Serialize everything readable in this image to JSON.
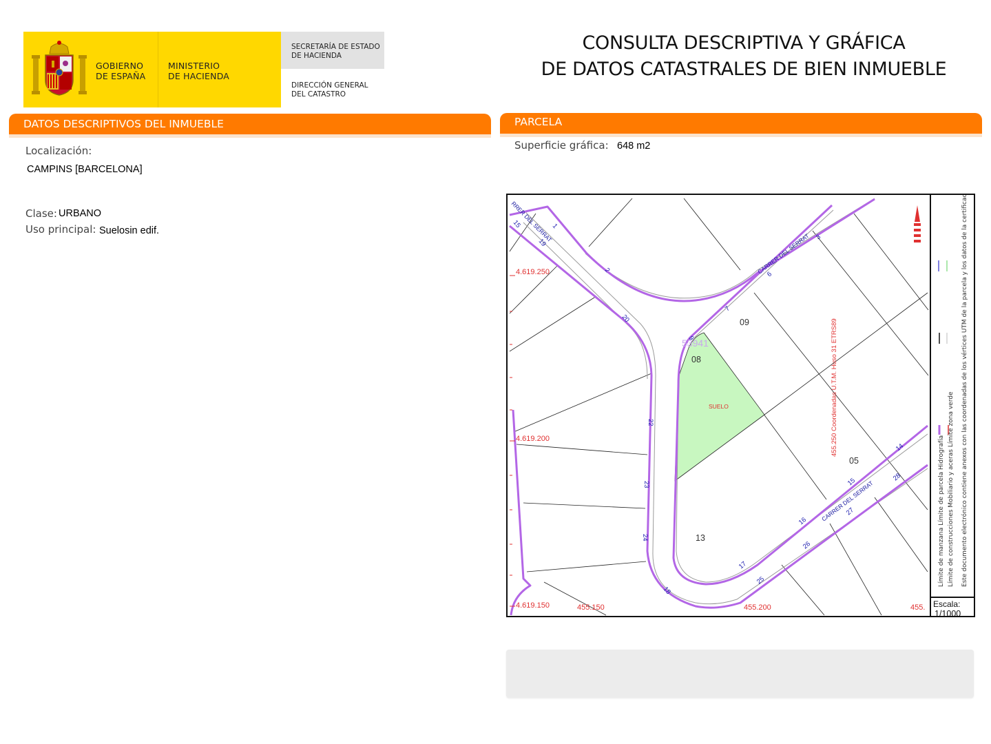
{
  "header": {
    "gov_line1": "GOBIERNO",
    "gov_line2": "DE ESPAÑA",
    "ministry_line1": "MINISTERIO",
    "ministry_line2": "DE HACIENDA",
    "secretaria_line1": "SECRETARÍA DE ESTADO",
    "secretaria_line2": "DE HACIENDA",
    "direccion_line1": "DIRECCIÓN GENERAL",
    "direccion_line2": "DEL CATASTRO",
    "title_line1": "CONSULTA DESCRIPTIVA Y GRÁFICA",
    "title_line2": "DE DATOS CATASTRALES DE BIEN INMUEBLE"
  },
  "left_section": {
    "heading": "DATOS DESCRIPTIVOS DEL INMUEBLE",
    "localizacion_label": "Localización:",
    "localizacion_value": "CAMPINS [BARCELONA]",
    "clase_label": "Clase:",
    "clase_value": "URBANO",
    "uso_label": "Uso principal:",
    "uso_value": "Suelosin edif."
  },
  "right_section": {
    "heading": "PARCELA",
    "superficie_label": "Superficie gráfica:",
    "superficie_value": "648 m2"
  },
  "map": {
    "street_labels": [
      "CARRER DEL SERRAT",
      "RRER DEL SERRAT",
      "CARRER DEL SERRAT"
    ],
    "parcel_numbers": [
      "09",
      "08",
      "05",
      "13"
    ],
    "parcel_land_label": "SUELO",
    "block_code": "53941",
    "house_numbers": [
      "1",
      "15",
      "19",
      "2",
      "20",
      "22",
      "23",
      "24",
      "18",
      "17",
      "25",
      "26",
      "16",
      "15",
      "14",
      "28",
      "27",
      "3",
      "6",
      "7",
      "9"
    ],
    "coord_y": [
      "4.619.250",
      "4.619.200",
      "4.619.150"
    ],
    "coord_x": [
      "455.150",
      "455.200",
      "455."
    ],
    "coord_system_label": "455.250 Coordenadas U.T.M. Huso 31 ETRS89",
    "colors": {
      "parcel_fill": "#c8f7c0",
      "block_line": "#b366e6",
      "coord_text": "#e03030",
      "street_text": "#1a1aa0"
    }
  },
  "legend": {
    "line1": "Límite de manzana   Límite de parcela   Hidrografía",
    "line2": "Límite de construcciones   Mobiliario y aceras   Límite zona verde",
    "line3": "Este documento electrónico contiene anexos con las coordenadas de los vértices UTM de la parcela y los datos de la certificación"
  },
  "scale": {
    "label": "Escala:",
    "value": "1/1000"
  }
}
